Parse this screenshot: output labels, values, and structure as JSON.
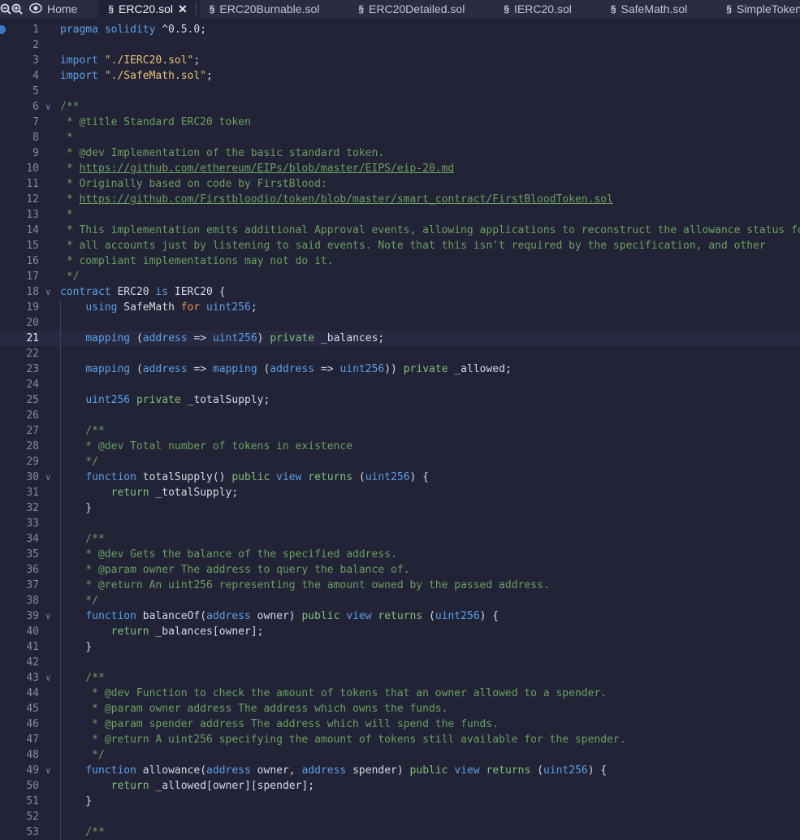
{
  "tabs": {
    "zoom_out": "−",
    "zoom_in": "+",
    "home": "Home",
    "items": [
      {
        "label": "ERC20.sol",
        "active": true
      },
      {
        "label": "ERC20Burnable.sol"
      },
      {
        "label": "ERC20Detailed.sol"
      },
      {
        "label": "IERC20.sol"
      },
      {
        "label": "SafeMath.sol"
      },
      {
        "label": "SimpleToken.sol"
      }
    ]
  },
  "editor": {
    "current_line": 21,
    "lines": [
      [
        [
          "kw",
          "pragma solidity "
        ],
        [
          "t",
          "^0.5.0;"
        ]
      ],
      [],
      [
        [
          "kw",
          "import "
        ],
        [
          "st",
          "\"./IERC20.sol\""
        ],
        [
          "t",
          ";"
        ]
      ],
      [
        [
          "kw",
          "import "
        ],
        [
          "st",
          "\"./SafeMath.sol\""
        ],
        [
          "t",
          ";"
        ]
      ],
      [],
      [
        [
          "cm",
          "/**"
        ]
      ],
      [
        [
          "cm",
          " * @title Standard ERC20 token"
        ]
      ],
      [
        [
          "cm",
          " *"
        ]
      ],
      [
        [
          "cm",
          " * @dev Implementation of the basic standard token."
        ]
      ],
      [
        [
          "cm",
          " * "
        ],
        [
          "cmu",
          "https://github.com/ethereum/EIPs/blob/master/EIPS/eip-20.md"
        ]
      ],
      [
        [
          "cm",
          " * Originally based on code by FirstBlood:"
        ]
      ],
      [
        [
          "cm",
          " * "
        ],
        [
          "cmu",
          "https://github.com/Firstbloodio/token/blob/master/smart_contract/FirstBloodToken.sol"
        ]
      ],
      [
        [
          "cm",
          " *"
        ]
      ],
      [
        [
          "cm",
          " * This implementation emits additional Approval events, allowing applications to reconstruct the allowance status for"
        ]
      ],
      [
        [
          "cm",
          " * all accounts just by listening to said events. Note that this isn't required by the specification, and other"
        ]
      ],
      [
        [
          "cm",
          " * compliant implementations may not do it."
        ]
      ],
      [
        [
          "cm",
          " */"
        ]
      ],
      [
        [
          "kw",
          "contract "
        ],
        [
          "t",
          "ERC20 "
        ],
        [
          "kw",
          "is "
        ],
        [
          "t",
          "IERC20 {"
        ]
      ],
      [
        [
          "t",
          "    "
        ],
        [
          "kw",
          "using "
        ],
        [
          "t",
          "SafeMath "
        ],
        [
          "ko",
          "for "
        ],
        [
          "kw",
          "uint256"
        ],
        [
          "t",
          ";"
        ]
      ],
      [],
      [
        [
          "t",
          "    "
        ],
        [
          "kw",
          "mapping "
        ],
        [
          "t",
          "("
        ],
        [
          "kw",
          "address"
        ],
        [
          "t",
          " => "
        ],
        [
          "kw",
          "uint256"
        ],
        [
          "t",
          ") "
        ],
        [
          "kg",
          "private "
        ],
        [
          "t",
          "_balances;"
        ]
      ],
      [],
      [
        [
          "t",
          "    "
        ],
        [
          "kw",
          "mapping "
        ],
        [
          "t",
          "("
        ],
        [
          "kw",
          "address"
        ],
        [
          "t",
          " => "
        ],
        [
          "kw",
          "mapping "
        ],
        [
          "t",
          "("
        ],
        [
          "kw",
          "address"
        ],
        [
          "t",
          " => "
        ],
        [
          "kw",
          "uint256"
        ],
        [
          "t",
          ")) "
        ],
        [
          "kg",
          "private "
        ],
        [
          "t",
          "_allowed;"
        ]
      ],
      [],
      [
        [
          "t",
          "    "
        ],
        [
          "kw",
          "uint256 "
        ],
        [
          "kg",
          "private "
        ],
        [
          "t",
          "_totalSupply;"
        ]
      ],
      [],
      [
        [
          "cm",
          "    /**"
        ]
      ],
      [
        [
          "cm",
          "    * @dev Total number of tokens in existence"
        ]
      ],
      [
        [
          "cm",
          "    */"
        ]
      ],
      [
        [
          "t",
          "    "
        ],
        [
          "kw",
          "function "
        ],
        [
          "t",
          "totalSupply() "
        ],
        [
          "kg",
          "public "
        ],
        [
          "kw",
          "view "
        ],
        [
          "kg",
          "returns "
        ],
        [
          "t",
          "("
        ],
        [
          "kw",
          "uint256"
        ],
        [
          "t",
          ") {"
        ]
      ],
      [
        [
          "t",
          "        "
        ],
        [
          "kg",
          "return "
        ],
        [
          "t",
          "_totalSupply;"
        ]
      ],
      [
        [
          "t",
          "    }"
        ]
      ],
      [],
      [
        [
          "cm",
          "    /**"
        ]
      ],
      [
        [
          "cm",
          "    * @dev Gets the balance of the specified address."
        ]
      ],
      [
        [
          "cm",
          "    * @param owner The address to query the balance of."
        ]
      ],
      [
        [
          "cm",
          "    * @return An uint256 representing the amount owned by the passed address."
        ]
      ],
      [
        [
          "cm",
          "    */"
        ]
      ],
      [
        [
          "t",
          "    "
        ],
        [
          "kw",
          "function "
        ],
        [
          "t",
          "balanceOf("
        ],
        [
          "kw",
          "address "
        ],
        [
          "t",
          "owner) "
        ],
        [
          "kg",
          "public "
        ],
        [
          "kw",
          "view "
        ],
        [
          "kg",
          "returns "
        ],
        [
          "t",
          "("
        ],
        [
          "kw",
          "uint256"
        ],
        [
          "t",
          ") {"
        ]
      ],
      [
        [
          "t",
          "        "
        ],
        [
          "kg",
          "return "
        ],
        [
          "t",
          "_balances[owner];"
        ]
      ],
      [
        [
          "t",
          "    }"
        ]
      ],
      [],
      [
        [
          "cm",
          "    /**"
        ]
      ],
      [
        [
          "cm",
          "     * @dev Function to check the amount of tokens that an owner allowed to a spender."
        ]
      ],
      [
        [
          "cm",
          "     * @param owner address The address which owns the funds."
        ]
      ],
      [
        [
          "cm",
          "     * @param spender address The address which will spend the funds."
        ]
      ],
      [
        [
          "cm",
          "     * @return A uint256 specifying the amount of tokens still available for the spender."
        ]
      ],
      [
        [
          "cm",
          "     */"
        ]
      ],
      [
        [
          "t",
          "    "
        ],
        [
          "kw",
          "function "
        ],
        [
          "t",
          "allowance("
        ],
        [
          "kw",
          "address "
        ],
        [
          "t",
          "owner, "
        ],
        [
          "kw",
          "address "
        ],
        [
          "t",
          "spender) "
        ],
        [
          "kg",
          "public "
        ],
        [
          "kw",
          "view "
        ],
        [
          "kg",
          "returns "
        ],
        [
          "t",
          "("
        ],
        [
          "kw",
          "uint256"
        ],
        [
          "t",
          ") {"
        ]
      ],
      [
        [
          "t",
          "        "
        ],
        [
          "kg",
          "return "
        ],
        [
          "t",
          "_allowed[owner][spender];"
        ]
      ],
      [
        [
          "t",
          "    }"
        ]
      ],
      [],
      [
        [
          "cm",
          "    /**"
        ]
      ]
    ],
    "folds": [
      6,
      18,
      30,
      39,
      43,
      49
    ],
    "guides_from": 19,
    "guides_to": 53
  }
}
